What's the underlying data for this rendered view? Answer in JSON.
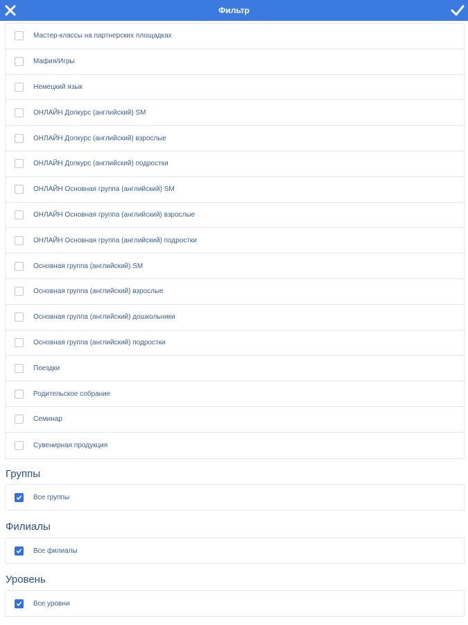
{
  "header": {
    "title": "Фильтр",
    "close_icon": "close-icon",
    "apply_icon": "checkmark-icon",
    "bg_color": "#3b7be0"
  },
  "categories": [
    {
      "label": "Мастер-классы на партнерских площадках",
      "checked": false
    },
    {
      "label": "Мафия/Игры",
      "checked": false
    },
    {
      "label": "Немецкий язык",
      "checked": false
    },
    {
      "label": "ОНЛАЙН Допкурс (английский) SM",
      "checked": false
    },
    {
      "label": "ОНЛАЙН Допкурс (английский) взрослые",
      "checked": false
    },
    {
      "label": "ОНЛАЙН Допкурс (английский) подростки",
      "checked": false
    },
    {
      "label": "ОНЛАЙН Основная группа (английский) SM",
      "checked": false
    },
    {
      "label": "ОНЛАЙН Основная группа (английский) взрослые",
      "checked": false
    },
    {
      "label": "ОНЛАЙН Основная группа (английский) подростки",
      "checked": false
    },
    {
      "label": "Основная группа (английский) SM",
      "checked": false
    },
    {
      "label": "Основная группа (английский) взрослые",
      "checked": false
    },
    {
      "label": "Основная группа (английский) дошкольники",
      "checked": false
    },
    {
      "label": "Основная группа (английский) подростки",
      "checked": false
    },
    {
      "label": "Поездки",
      "checked": false
    },
    {
      "label": "Родительское собрание",
      "checked": false
    },
    {
      "label": "Семинар",
      "checked": false
    },
    {
      "label": "Сувенирная продукция",
      "checked": false
    }
  ],
  "groups": {
    "title": "Группы",
    "items": [
      {
        "label": "Все группы",
        "checked": true
      }
    ]
  },
  "branches": {
    "title": "Филиалы",
    "items": [
      {
        "label": "Все филиалы",
        "checked": true
      }
    ]
  },
  "levels": {
    "title": "Уровень",
    "items": [
      {
        "label": "Все уровни",
        "checked": true
      }
    ]
  },
  "colors": {
    "checkbox_checked": "#2f6fe0",
    "text": "#3a5f95"
  }
}
